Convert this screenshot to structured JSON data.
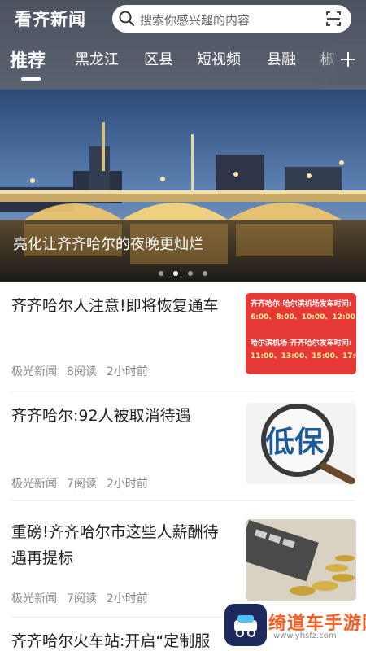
{
  "header": {
    "app_title": "看齐新闻",
    "search_placeholder": "搜索你感兴趣的内容",
    "icons": {
      "search": "search-icon",
      "scan": "scan-icon",
      "add": "plus-icon"
    },
    "background": "#555d6b"
  },
  "tabs": [
    {
      "label": "推荐",
      "active": true
    },
    {
      "label": "黑龙江",
      "active": false
    },
    {
      "label": "区县",
      "active": false
    },
    {
      "label": "短视频",
      "active": false
    },
    {
      "label": "县融",
      "active": false
    },
    {
      "label": "椒",
      "active": false
    }
  ],
  "banner": {
    "caption": "亮化让齐齐哈尔的夜晚更灿烂",
    "page_count": 4,
    "current_page": 2
  },
  "news": [
    {
      "title": "齐齐哈尔人注意!即将恢复通车",
      "source": "极光新闻",
      "reads": "8阅读",
      "time": "2小时前",
      "thumb_lines": [
        "齐齐哈尔-哈尔滨机场发车时间:",
        "6:00、8:00、10:00、12:00",
        "哈尔滨机场-齐齐哈尔发车时间:",
        "11:00、13:00、15:00、17:00"
      ]
    },
    {
      "title": "齐齐哈尔:92人被取消待遇",
      "source": "极光新闻",
      "reads": "7阅读",
      "time": "2小时前",
      "thumb_text": "低保"
    },
    {
      "title": "重磅!齐齐哈尔市这些人薪酬待遇再提标",
      "source": "极光新闻",
      "reads": "7阅读",
      "time": "2小时前"
    },
    {
      "title": "齐齐哈尔火车站:开启“定制服"
    }
  ],
  "watermark": {
    "text": "绮道车手游网",
    "url": "www.yhsfz.com"
  }
}
